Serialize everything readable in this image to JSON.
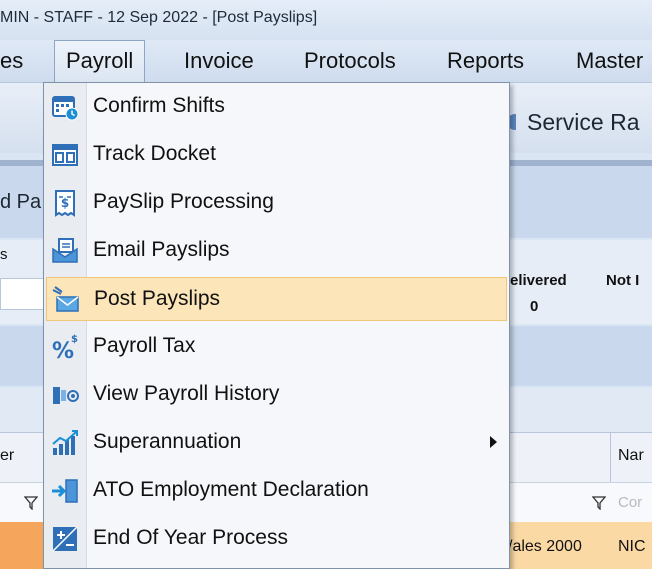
{
  "window": {
    "title": "MIN - STAFF - 12 Sep 2022 - [Post Payslips]"
  },
  "menubar": {
    "items": [
      {
        "label": "es"
      },
      {
        "label": "Payroll"
      },
      {
        "label": "Invoice"
      },
      {
        "label": "Protocols"
      },
      {
        "label": "Reports"
      },
      {
        "label": "Master"
      }
    ]
  },
  "background": {
    "ribbon_label": "Service Ra",
    "tab_fragment": "d Pa",
    "fragment_s": "s",
    "delivered_label": "elivered",
    "delivered_value": "0",
    "not_label": "Not I",
    "col_left": "er",
    "col_right": "Nar",
    "filter_right_text": "Cor",
    "row_address": "/ales 2000",
    "row_name": "NIC"
  },
  "dropdown": {
    "items": [
      {
        "label": "Confirm Shifts",
        "icon": "calendar-clock-icon"
      },
      {
        "label": "Track Docket",
        "icon": "docket-board-icon"
      },
      {
        "label": "PaySlip Processing",
        "icon": "payslip-receipt-icon"
      },
      {
        "label": "Email Payslips",
        "icon": "email-payslip-icon"
      },
      {
        "label": "Post Payslips",
        "icon": "post-envelope-icon",
        "highlighted": true
      },
      {
        "label": "Payroll Tax",
        "icon": "percent-dollar-icon"
      },
      {
        "label": "View Payroll History",
        "icon": "history-view-icon"
      },
      {
        "label": "Superannuation",
        "icon": "chart-growth-icon",
        "submenu": true
      },
      {
        "label": "ATO Employment Declaration",
        "icon": "declaration-arrow-icon"
      },
      {
        "label": "End Of Year Process",
        "icon": "plus-minus-icon"
      }
    ]
  }
}
